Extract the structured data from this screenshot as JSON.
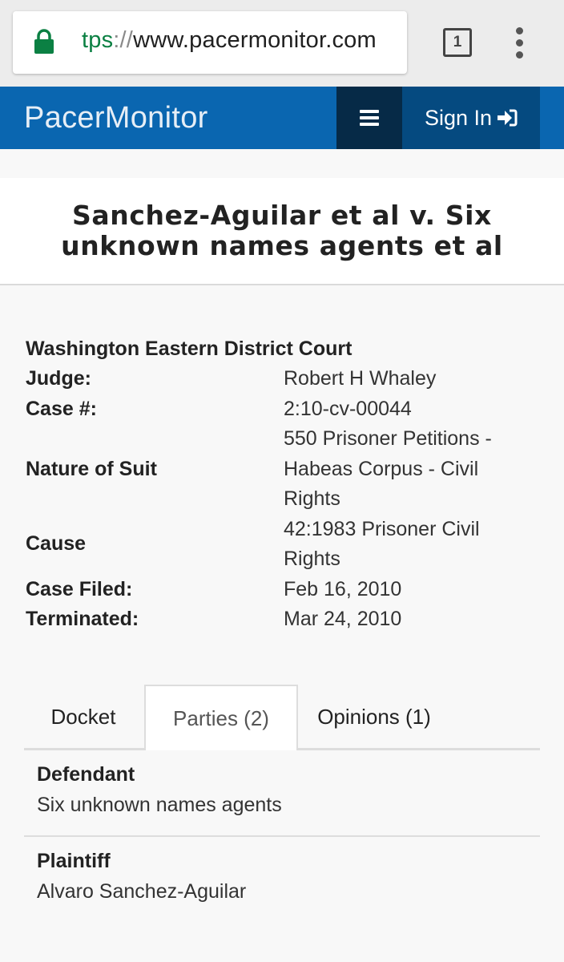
{
  "browser": {
    "url_scheme": "tps",
    "url_separator": "://",
    "url_host": "www.pacermonitor.com",
    "tab_count": "1",
    "icons": {
      "lock": "lock-icon",
      "menu": "kebab-menu-icon"
    },
    "lock_color": "#0b8043"
  },
  "header": {
    "logo": "PacerMonitor",
    "sign_in_label": "Sign In",
    "icons": {
      "menu": "hamburger-icon",
      "sign_in": "sign-in-icon"
    },
    "bg_color": "#0a66b0"
  },
  "case": {
    "title": "Sanchez-Aguilar et al v. Six unknown names agents et al",
    "court": "Washington Eastern District Court",
    "details": [
      {
        "label": "Judge:",
        "value": "Robert H Whaley"
      },
      {
        "label": "Case #:",
        "value": "2:10-cv-00044"
      },
      {
        "label": "Nature of Suit",
        "value": "550 Prisoner Petitions - Habeas Corpus - Civil Rights"
      },
      {
        "label": "Cause",
        "value": "42:1983 Prisoner Civil Rights"
      },
      {
        "label": "Case Filed:",
        "value": "Feb 16, 2010"
      },
      {
        "label": "Terminated:",
        "value": "Mar 24, 2010"
      }
    ]
  },
  "tabs": [
    {
      "label": "Docket",
      "active": false
    },
    {
      "label": "Parties (2)",
      "active": true
    },
    {
      "label": "Opinions (1)",
      "active": false
    }
  ],
  "parties": [
    {
      "role": "Defendant",
      "name": "Six unknown names agents"
    },
    {
      "role": "Plaintiff",
      "name": "Alvaro Sanchez-Aguilar"
    }
  ]
}
